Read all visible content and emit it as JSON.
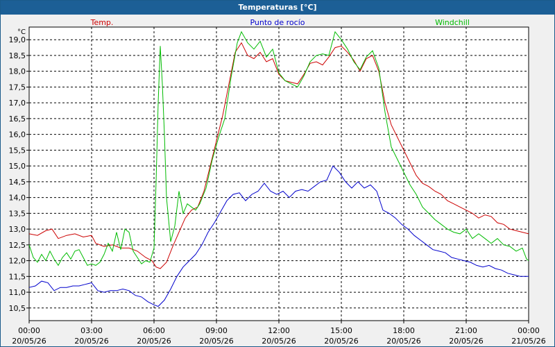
{
  "window": {
    "title": "Temperaturas [°C]"
  },
  "chart_data": {
    "type": "line",
    "title": "Temperaturas [°C]",
    "ylabel": "°C",
    "ylim": [
      10.1,
      19.4
    ],
    "yticks": [
      10.5,
      11.0,
      11.5,
      12.0,
      12.5,
      13.0,
      13.5,
      14.0,
      14.5,
      15.0,
      15.5,
      16.0,
      16.5,
      17.0,
      17.5,
      18.0,
      18.5,
      19.0
    ],
    "xlim": [
      0,
      24
    ],
    "xticks": [
      {
        "h": 0,
        "time": "00:00",
        "date": "20/05/26"
      },
      {
        "h": 3,
        "time": "03:00",
        "date": "20/05/26"
      },
      {
        "h": 6,
        "time": "06:00",
        "date": "20/05/26"
      },
      {
        "h": 9,
        "time": "09:00",
        "date": "20/05/26"
      },
      {
        "h": 12,
        "time": "12:00",
        "date": "20/05/26"
      },
      {
        "h": 15,
        "time": "15:00",
        "date": "20/05/26"
      },
      {
        "h": 18,
        "time": "18:00",
        "date": "20/05/26"
      },
      {
        "h": 21,
        "time": "21:00",
        "date": "20/05/26"
      },
      {
        "h": 24,
        "time": "00:00",
        "date": "21/05/26"
      }
    ],
    "grid": true,
    "legend": "top",
    "series": [
      {
        "name": "Temp.",
        "color": "#cc0000",
        "points": [
          [
            0,
            12.85
          ],
          [
            0.4,
            12.8
          ],
          [
            0.8,
            12.95
          ],
          [
            1.1,
            13.0
          ],
          [
            1.4,
            12.7
          ],
          [
            1.8,
            12.8
          ],
          [
            2.2,
            12.85
          ],
          [
            2.6,
            12.75
          ],
          [
            3.0,
            12.8
          ],
          [
            3.2,
            12.55
          ],
          [
            3.6,
            12.45
          ],
          [
            4.0,
            12.5
          ],
          [
            4.4,
            12.4
          ],
          [
            4.8,
            12.4
          ],
          [
            5.2,
            12.3
          ],
          [
            5.6,
            12.1
          ],
          [
            5.9,
            12.0
          ],
          [
            6.1,
            11.8
          ],
          [
            6.3,
            11.75
          ],
          [
            6.6,
            11.95
          ],
          [
            6.9,
            12.45
          ],
          [
            7.2,
            12.9
          ],
          [
            7.5,
            13.35
          ],
          [
            7.8,
            13.6
          ],
          [
            8.1,
            13.7
          ],
          [
            8.4,
            14.2
          ],
          [
            8.7,
            15.0
          ],
          [
            9.0,
            15.8
          ],
          [
            9.3,
            16.6
          ],
          [
            9.6,
            17.6
          ],
          [
            9.9,
            18.6
          ],
          [
            10.2,
            18.9
          ],
          [
            10.5,
            18.5
          ],
          [
            10.8,
            18.4
          ],
          [
            11.1,
            18.6
          ],
          [
            11.4,
            18.3
          ],
          [
            11.7,
            18.4
          ],
          [
            12.0,
            17.9
          ],
          [
            12.3,
            17.7
          ],
          [
            12.6,
            17.65
          ],
          [
            12.9,
            17.6
          ],
          [
            13.2,
            17.9
          ],
          [
            13.5,
            18.25
          ],
          [
            13.8,
            18.3
          ],
          [
            14.1,
            18.2
          ],
          [
            14.4,
            18.45
          ],
          [
            14.7,
            18.75
          ],
          [
            15.0,
            18.8
          ],
          [
            15.3,
            18.6
          ],
          [
            15.6,
            18.35
          ],
          [
            15.9,
            18.0
          ],
          [
            16.2,
            18.4
          ],
          [
            16.5,
            18.5
          ],
          [
            16.8,
            18.0
          ],
          [
            17.1,
            17.0
          ],
          [
            17.4,
            16.3
          ],
          [
            17.7,
            15.9
          ],
          [
            18.0,
            15.5
          ],
          [
            18.3,
            15.1
          ],
          [
            18.6,
            14.7
          ],
          [
            18.9,
            14.45
          ],
          [
            19.2,
            14.35
          ],
          [
            19.5,
            14.2
          ],
          [
            19.8,
            14.1
          ],
          [
            20.1,
            13.9
          ],
          [
            20.4,
            13.8
          ],
          [
            20.7,
            13.7
          ],
          [
            21.0,
            13.6
          ],
          [
            21.3,
            13.5
          ],
          [
            21.6,
            13.35
          ],
          [
            21.9,
            13.45
          ],
          [
            22.2,
            13.4
          ],
          [
            22.5,
            13.2
          ],
          [
            22.8,
            13.15
          ],
          [
            23.1,
            13.0
          ],
          [
            23.4,
            12.95
          ],
          [
            23.7,
            12.9
          ],
          [
            24.0,
            12.85
          ]
        ]
      },
      {
        "name": "Punto de rocío",
        "color": "#0000cc",
        "points": [
          [
            0,
            11.15
          ],
          [
            0.3,
            11.2
          ],
          [
            0.6,
            11.35
          ],
          [
            0.9,
            11.3
          ],
          [
            1.2,
            11.05
          ],
          [
            1.5,
            11.15
          ],
          [
            1.8,
            11.15
          ],
          [
            2.1,
            11.2
          ],
          [
            2.4,
            11.2
          ],
          [
            2.7,
            11.25
          ],
          [
            3.0,
            11.3
          ],
          [
            3.3,
            11.05
          ],
          [
            3.6,
            11.0
          ],
          [
            3.9,
            11.05
          ],
          [
            4.2,
            11.05
          ],
          [
            4.5,
            11.1
          ],
          [
            4.8,
            11.05
          ],
          [
            5.1,
            10.9
          ],
          [
            5.4,
            10.85
          ],
          [
            5.7,
            10.7
          ],
          [
            6.0,
            10.6
          ],
          [
            6.2,
            10.55
          ],
          [
            6.5,
            10.75
          ],
          [
            6.8,
            11.1
          ],
          [
            7.1,
            11.5
          ],
          [
            7.4,
            11.8
          ],
          [
            7.7,
            12.0
          ],
          [
            8.0,
            12.2
          ],
          [
            8.3,
            12.5
          ],
          [
            8.6,
            12.9
          ],
          [
            8.9,
            13.2
          ],
          [
            9.2,
            13.55
          ],
          [
            9.5,
            13.9
          ],
          [
            9.8,
            14.1
          ],
          [
            10.1,
            14.15
          ],
          [
            10.4,
            13.9
          ],
          [
            10.7,
            14.1
          ],
          [
            11.0,
            14.2
          ],
          [
            11.3,
            14.45
          ],
          [
            11.6,
            14.2
          ],
          [
            11.9,
            14.1
          ],
          [
            12.2,
            14.2
          ],
          [
            12.5,
            14.0
          ],
          [
            12.8,
            14.2
          ],
          [
            13.1,
            14.25
          ],
          [
            13.4,
            14.2
          ],
          [
            13.7,
            14.35
          ],
          [
            14.0,
            14.5
          ],
          [
            14.3,
            14.55
          ],
          [
            14.6,
            15.0
          ],
          [
            14.9,
            14.8
          ],
          [
            15.2,
            14.5
          ],
          [
            15.5,
            14.3
          ],
          [
            15.8,
            14.5
          ],
          [
            16.1,
            14.3
          ],
          [
            16.4,
            14.4
          ],
          [
            16.7,
            14.2
          ],
          [
            17.0,
            13.6
          ],
          [
            17.3,
            13.5
          ],
          [
            17.6,
            13.35
          ],
          [
            17.9,
            13.15
          ],
          [
            18.2,
            13.0
          ],
          [
            18.5,
            12.8
          ],
          [
            18.8,
            12.65
          ],
          [
            19.1,
            12.5
          ],
          [
            19.4,
            12.35
          ],
          [
            19.7,
            12.3
          ],
          [
            20.0,
            12.25
          ],
          [
            20.3,
            12.1
          ],
          [
            20.6,
            12.05
          ],
          [
            20.9,
            12.0
          ],
          [
            21.2,
            11.95
          ],
          [
            21.5,
            11.85
          ],
          [
            21.8,
            11.8
          ],
          [
            22.1,
            11.85
          ],
          [
            22.4,
            11.75
          ],
          [
            22.7,
            11.7
          ],
          [
            23.0,
            11.6
          ],
          [
            23.3,
            11.55
          ],
          [
            23.6,
            11.5
          ],
          [
            23.9,
            11.5
          ],
          [
            24.0,
            11.5
          ]
        ]
      },
      {
        "name": "Windchill",
        "color": "#00bb00",
        "points": [
          [
            0,
            12.5
          ],
          [
            0.2,
            12.1
          ],
          [
            0.4,
            11.95
          ],
          [
            0.6,
            12.2
          ],
          [
            0.8,
            12.0
          ],
          [
            1.0,
            12.3
          ],
          [
            1.2,
            12.05
          ],
          [
            1.4,
            11.85
          ],
          [
            1.6,
            12.1
          ],
          [
            1.8,
            12.25
          ],
          [
            2.0,
            12.05
          ],
          [
            2.2,
            12.3
          ],
          [
            2.4,
            12.35
          ],
          [
            2.6,
            12.1
          ],
          [
            2.8,
            11.85
          ],
          [
            3.0,
            11.9
          ],
          [
            3.2,
            11.85
          ],
          [
            3.4,
            11.95
          ],
          [
            3.6,
            12.2
          ],
          [
            3.8,
            12.55
          ],
          [
            4.0,
            12.3
          ],
          [
            4.2,
            12.9
          ],
          [
            4.4,
            12.35
          ],
          [
            4.6,
            13.0
          ],
          [
            4.8,
            12.9
          ],
          [
            5.0,
            12.3
          ],
          [
            5.2,
            12.1
          ],
          [
            5.4,
            11.9
          ],
          [
            5.6,
            12.0
          ],
          [
            5.8,
            11.95
          ],
          [
            6.0,
            12.4
          ],
          [
            6.1,
            14.5
          ],
          [
            6.2,
            17.0
          ],
          [
            6.3,
            18.8
          ],
          [
            6.4,
            17.6
          ],
          [
            6.5,
            16.0
          ],
          [
            6.6,
            14.0
          ],
          [
            6.8,
            12.6
          ],
          [
            7.0,
            13.1
          ],
          [
            7.2,
            14.2
          ],
          [
            7.4,
            13.5
          ],
          [
            7.6,
            13.8
          ],
          [
            7.8,
            13.7
          ],
          [
            8.0,
            13.6
          ],
          [
            8.2,
            13.8
          ],
          [
            8.5,
            14.3
          ],
          [
            8.8,
            15.2
          ],
          [
            9.1,
            15.9
          ],
          [
            9.4,
            16.5
          ],
          [
            9.7,
            17.8
          ],
          [
            10.0,
            18.9
          ],
          [
            10.2,
            19.25
          ],
          [
            10.5,
            18.9
          ],
          [
            10.8,
            18.7
          ],
          [
            11.1,
            18.95
          ],
          [
            11.4,
            18.45
          ],
          [
            11.7,
            18.7
          ],
          [
            12.0,
            17.95
          ],
          [
            12.3,
            17.7
          ],
          [
            12.6,
            17.6
          ],
          [
            12.9,
            17.5
          ],
          [
            13.2,
            17.85
          ],
          [
            13.5,
            18.3
          ],
          [
            13.8,
            18.5
          ],
          [
            14.1,
            18.55
          ],
          [
            14.4,
            18.5
          ],
          [
            14.7,
            19.25
          ],
          [
            15.0,
            19.0
          ],
          [
            15.3,
            18.7
          ],
          [
            15.6,
            18.3
          ],
          [
            15.9,
            18.05
          ],
          [
            16.2,
            18.45
          ],
          [
            16.5,
            18.65
          ],
          [
            16.8,
            18.1
          ],
          [
            17.1,
            16.7
          ],
          [
            17.4,
            15.6
          ],
          [
            17.7,
            15.2
          ],
          [
            18.0,
            14.8
          ],
          [
            18.3,
            14.4
          ],
          [
            18.6,
            14.1
          ],
          [
            18.9,
            13.7
          ],
          [
            19.2,
            13.5
          ],
          [
            19.5,
            13.3
          ],
          [
            19.8,
            13.15
          ],
          [
            20.1,
            13.0
          ],
          [
            20.4,
            12.9
          ],
          [
            20.7,
            12.85
          ],
          [
            21.0,
            13.0
          ],
          [
            21.3,
            12.7
          ],
          [
            21.6,
            12.85
          ],
          [
            21.9,
            12.7
          ],
          [
            22.2,
            12.55
          ],
          [
            22.5,
            12.7
          ],
          [
            22.8,
            12.5
          ],
          [
            23.1,
            12.45
          ],
          [
            23.4,
            12.3
          ],
          [
            23.7,
            12.4
          ],
          [
            23.9,
            12.05
          ],
          [
            24.0,
            12.0
          ]
        ]
      }
    ]
  }
}
